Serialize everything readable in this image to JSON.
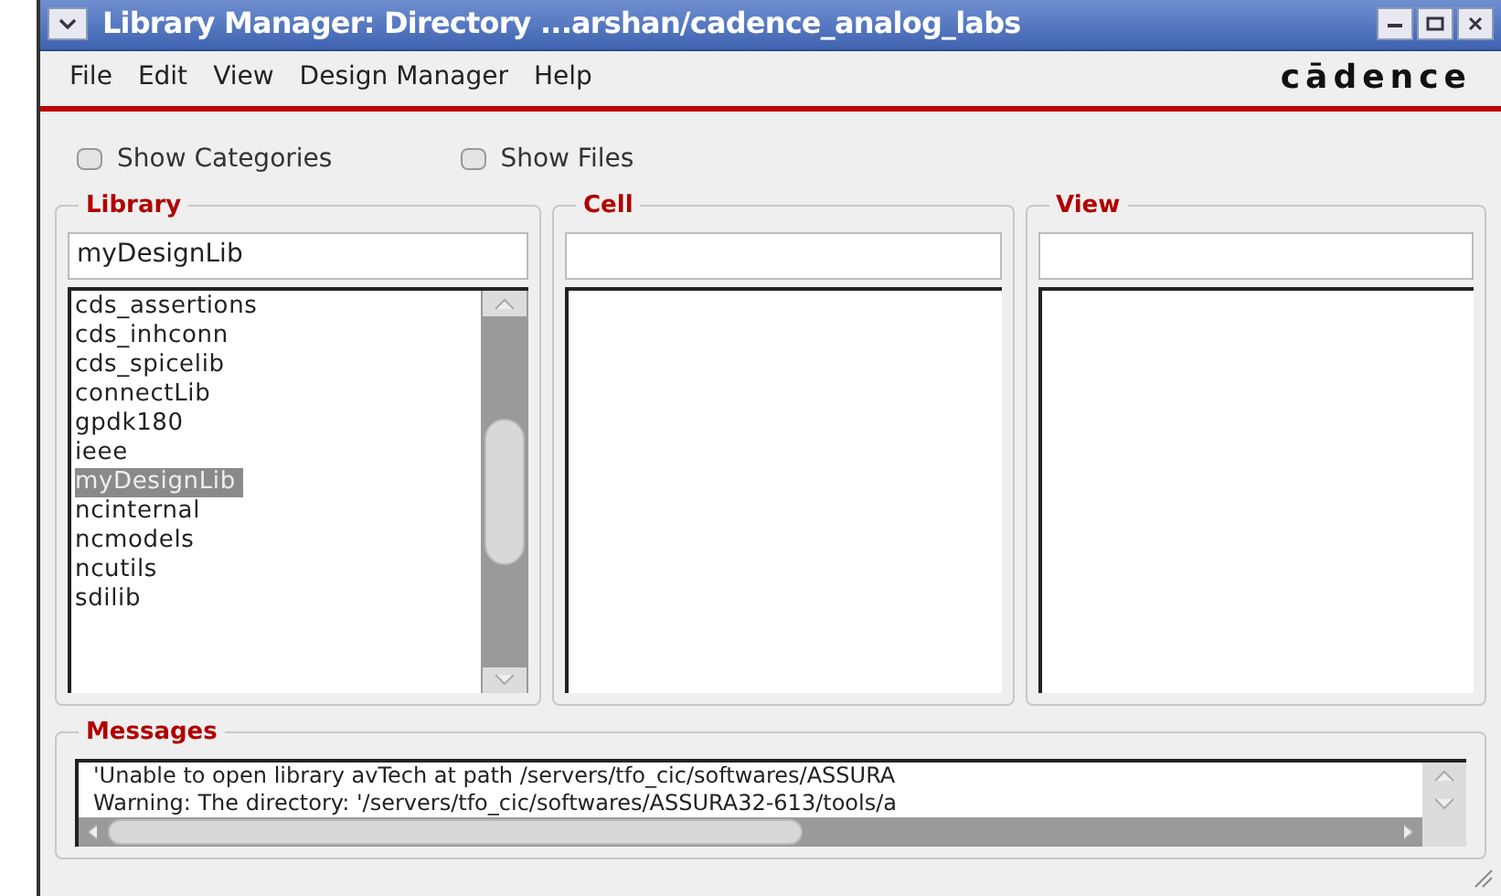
{
  "window": {
    "title": "Library Manager: Directory ...arshan/cadence_analog_labs"
  },
  "menu": [
    "File",
    "Edit",
    "View",
    "Design Manager",
    "Help"
  ],
  "logo": "cādence",
  "options": [
    {
      "label": "Show Categories",
      "checked": false
    },
    {
      "label": "Show Files",
      "checked": false
    }
  ],
  "panes": [
    {
      "title": "Library",
      "filter": "myDesignLib",
      "items": [
        {
          "label": "cds_assertions",
          "selected": false
        },
        {
          "label": "cds_inhconn",
          "selected": false
        },
        {
          "label": "cds_spicelib",
          "selected": false
        },
        {
          "label": "connectLib",
          "selected": false
        },
        {
          "label": "gpdk180",
          "selected": false
        },
        {
          "label": "ieee",
          "selected": false
        },
        {
          "label": "myDesignLib",
          "selected": true
        },
        {
          "label": "ncinternal",
          "selected": false
        },
        {
          "label": "ncmodels",
          "selected": false
        },
        {
          "label": "ncutils",
          "selected": false
        },
        {
          "label": "sdilib",
          "selected": false
        }
      ]
    },
    {
      "title": "Cell"
    },
    {
      "title": "View"
    }
  ],
  "messages": {
    "title": "Messages",
    "lines": [
      "'Unable to open library avTech at path /servers/tfo_cic/softwares/ASSURA",
      "Warning: The directory: '/servers/tfo_cic/softwares/ASSURA32-613/tools/a"
    ]
  }
}
